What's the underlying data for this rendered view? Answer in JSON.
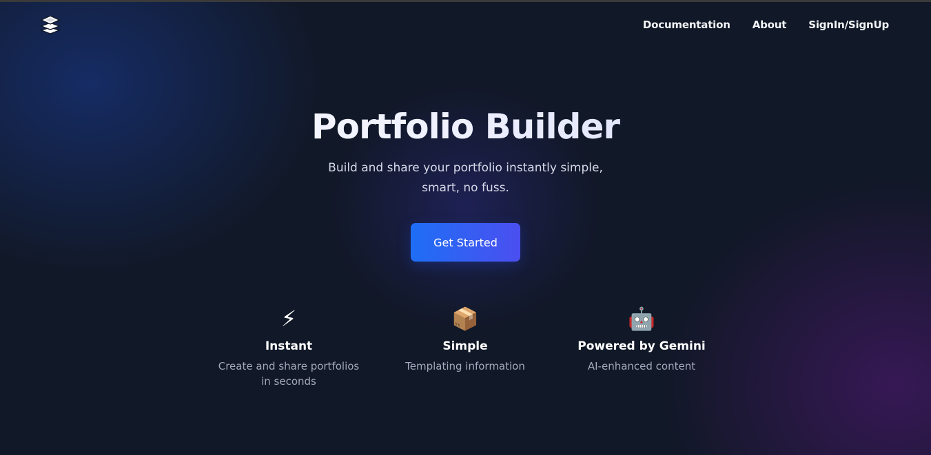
{
  "header": {
    "logo_icon": "layers-stack-icon",
    "nav": [
      {
        "label": "Documentation"
      },
      {
        "label": "About"
      },
      {
        "label": "SignIn/SignUp"
      }
    ]
  },
  "hero": {
    "title": "Portfolio Builder",
    "subtitle": "Build and share your portfolio instantly simple, smart, no fuss.",
    "cta_label": "Get Started"
  },
  "features": [
    {
      "icon": "⚡",
      "icon_name": "lightning-icon",
      "title": "Instant",
      "description": "Create and share portfolios in seconds"
    },
    {
      "icon": "📦",
      "icon_name": "package-icon",
      "title": "Simple",
      "description": "Templating information"
    },
    {
      "icon": "🤖",
      "icon_name": "robot-icon",
      "title": "Powered by Gemini",
      "description": "AI-enhanced content"
    }
  ],
  "colors": {
    "background": "#111827",
    "button_gradient_start": "#1e6ef5",
    "button_gradient_end": "#4b4ff0",
    "muted_text": "#a3a9bc"
  }
}
